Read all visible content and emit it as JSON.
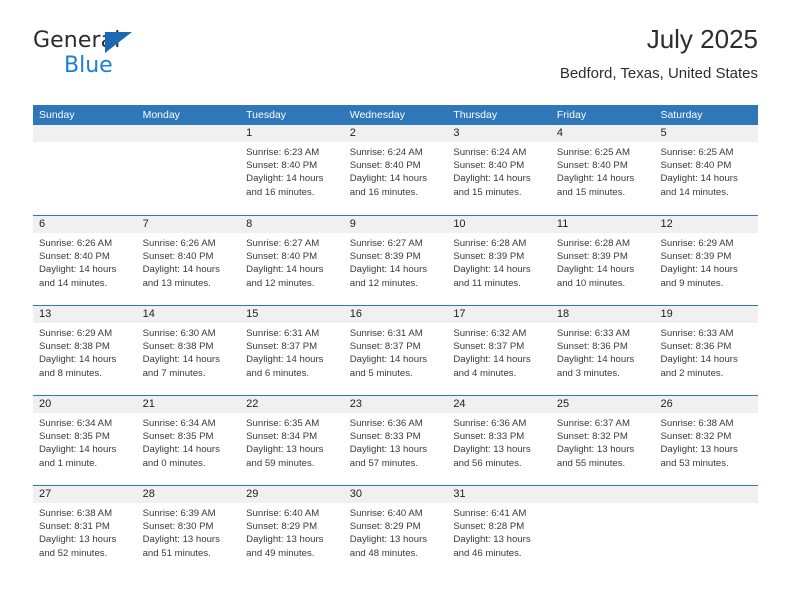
{
  "brand": {
    "name_top": "General",
    "name_bottom": "Blue",
    "triangle_color": "#1b69b2",
    "blue_color": "#1b7fd4"
  },
  "header": {
    "title": "July 2025",
    "subtitle": "Bedford, Texas, United States"
  },
  "theme": {
    "header_band": "#2e77b8",
    "day_band": "#f0f0f0",
    "text": "#222222"
  },
  "calendar": {
    "weekday_headers": [
      "Sunday",
      "Monday",
      "Tuesday",
      "Wednesday",
      "Thursday",
      "Friday",
      "Saturday"
    ],
    "weeks": [
      [
        {
          "day": "",
          "sunrise": "",
          "sunset": "",
          "daylight_1": "",
          "daylight_2": ""
        },
        {
          "day": "",
          "sunrise": "",
          "sunset": "",
          "daylight_1": "",
          "daylight_2": ""
        },
        {
          "day": "1",
          "sunrise": "Sunrise: 6:23 AM",
          "sunset": "Sunset: 8:40 PM",
          "daylight_1": "Daylight: 14 hours",
          "daylight_2": "and 16 minutes."
        },
        {
          "day": "2",
          "sunrise": "Sunrise: 6:24 AM",
          "sunset": "Sunset: 8:40 PM",
          "daylight_1": "Daylight: 14 hours",
          "daylight_2": "and 16 minutes."
        },
        {
          "day": "3",
          "sunrise": "Sunrise: 6:24 AM",
          "sunset": "Sunset: 8:40 PM",
          "daylight_1": "Daylight: 14 hours",
          "daylight_2": "and 15 minutes."
        },
        {
          "day": "4",
          "sunrise": "Sunrise: 6:25 AM",
          "sunset": "Sunset: 8:40 PM",
          "daylight_1": "Daylight: 14 hours",
          "daylight_2": "and 15 minutes."
        },
        {
          "day": "5",
          "sunrise": "Sunrise: 6:25 AM",
          "sunset": "Sunset: 8:40 PM",
          "daylight_1": "Daylight: 14 hours",
          "daylight_2": "and 14 minutes."
        }
      ],
      [
        {
          "day": "6",
          "sunrise": "Sunrise: 6:26 AM",
          "sunset": "Sunset: 8:40 PM",
          "daylight_1": "Daylight: 14 hours",
          "daylight_2": "and 14 minutes."
        },
        {
          "day": "7",
          "sunrise": "Sunrise: 6:26 AM",
          "sunset": "Sunset: 8:40 PM",
          "daylight_1": "Daylight: 14 hours",
          "daylight_2": "and 13 minutes."
        },
        {
          "day": "8",
          "sunrise": "Sunrise: 6:27 AM",
          "sunset": "Sunset: 8:40 PM",
          "daylight_1": "Daylight: 14 hours",
          "daylight_2": "and 12 minutes."
        },
        {
          "day": "9",
          "sunrise": "Sunrise: 6:27 AM",
          "sunset": "Sunset: 8:39 PM",
          "daylight_1": "Daylight: 14 hours",
          "daylight_2": "and 12 minutes."
        },
        {
          "day": "10",
          "sunrise": "Sunrise: 6:28 AM",
          "sunset": "Sunset: 8:39 PM",
          "daylight_1": "Daylight: 14 hours",
          "daylight_2": "and 11 minutes."
        },
        {
          "day": "11",
          "sunrise": "Sunrise: 6:28 AM",
          "sunset": "Sunset: 8:39 PM",
          "daylight_1": "Daylight: 14 hours",
          "daylight_2": "and 10 minutes."
        },
        {
          "day": "12",
          "sunrise": "Sunrise: 6:29 AM",
          "sunset": "Sunset: 8:39 PM",
          "daylight_1": "Daylight: 14 hours",
          "daylight_2": "and 9 minutes."
        }
      ],
      [
        {
          "day": "13",
          "sunrise": "Sunrise: 6:29 AM",
          "sunset": "Sunset: 8:38 PM",
          "daylight_1": "Daylight: 14 hours",
          "daylight_2": "and 8 minutes."
        },
        {
          "day": "14",
          "sunrise": "Sunrise: 6:30 AM",
          "sunset": "Sunset: 8:38 PM",
          "daylight_1": "Daylight: 14 hours",
          "daylight_2": "and 7 minutes."
        },
        {
          "day": "15",
          "sunrise": "Sunrise: 6:31 AM",
          "sunset": "Sunset: 8:37 PM",
          "daylight_1": "Daylight: 14 hours",
          "daylight_2": "and 6 minutes."
        },
        {
          "day": "16",
          "sunrise": "Sunrise: 6:31 AM",
          "sunset": "Sunset: 8:37 PM",
          "daylight_1": "Daylight: 14 hours",
          "daylight_2": "and 5 minutes."
        },
        {
          "day": "17",
          "sunrise": "Sunrise: 6:32 AM",
          "sunset": "Sunset: 8:37 PM",
          "daylight_1": "Daylight: 14 hours",
          "daylight_2": "and 4 minutes."
        },
        {
          "day": "18",
          "sunrise": "Sunrise: 6:33 AM",
          "sunset": "Sunset: 8:36 PM",
          "daylight_1": "Daylight: 14 hours",
          "daylight_2": "and 3 minutes."
        },
        {
          "day": "19",
          "sunrise": "Sunrise: 6:33 AM",
          "sunset": "Sunset: 8:36 PM",
          "daylight_1": "Daylight: 14 hours",
          "daylight_2": "and 2 minutes."
        }
      ],
      [
        {
          "day": "20",
          "sunrise": "Sunrise: 6:34 AM",
          "sunset": "Sunset: 8:35 PM",
          "daylight_1": "Daylight: 14 hours",
          "daylight_2": "and 1 minute."
        },
        {
          "day": "21",
          "sunrise": "Sunrise: 6:34 AM",
          "sunset": "Sunset: 8:35 PM",
          "daylight_1": "Daylight: 14 hours",
          "daylight_2": "and 0 minutes."
        },
        {
          "day": "22",
          "sunrise": "Sunrise: 6:35 AM",
          "sunset": "Sunset: 8:34 PM",
          "daylight_1": "Daylight: 13 hours",
          "daylight_2": "and 59 minutes."
        },
        {
          "day": "23",
          "sunrise": "Sunrise: 6:36 AM",
          "sunset": "Sunset: 8:33 PM",
          "daylight_1": "Daylight: 13 hours",
          "daylight_2": "and 57 minutes."
        },
        {
          "day": "24",
          "sunrise": "Sunrise: 6:36 AM",
          "sunset": "Sunset: 8:33 PM",
          "daylight_1": "Daylight: 13 hours",
          "daylight_2": "and 56 minutes."
        },
        {
          "day": "25",
          "sunrise": "Sunrise: 6:37 AM",
          "sunset": "Sunset: 8:32 PM",
          "daylight_1": "Daylight: 13 hours",
          "daylight_2": "and 55 minutes."
        },
        {
          "day": "26",
          "sunrise": "Sunrise: 6:38 AM",
          "sunset": "Sunset: 8:32 PM",
          "daylight_1": "Daylight: 13 hours",
          "daylight_2": "and 53 minutes."
        }
      ],
      [
        {
          "day": "27",
          "sunrise": "Sunrise: 6:38 AM",
          "sunset": "Sunset: 8:31 PM",
          "daylight_1": "Daylight: 13 hours",
          "daylight_2": "and 52 minutes."
        },
        {
          "day": "28",
          "sunrise": "Sunrise: 6:39 AM",
          "sunset": "Sunset: 8:30 PM",
          "daylight_1": "Daylight: 13 hours",
          "daylight_2": "and 51 minutes."
        },
        {
          "day": "29",
          "sunrise": "Sunrise: 6:40 AM",
          "sunset": "Sunset: 8:29 PM",
          "daylight_1": "Daylight: 13 hours",
          "daylight_2": "and 49 minutes."
        },
        {
          "day": "30",
          "sunrise": "Sunrise: 6:40 AM",
          "sunset": "Sunset: 8:29 PM",
          "daylight_1": "Daylight: 13 hours",
          "daylight_2": "and 48 minutes."
        },
        {
          "day": "31",
          "sunrise": "Sunrise: 6:41 AM",
          "sunset": "Sunset: 8:28 PM",
          "daylight_1": "Daylight: 13 hours",
          "daylight_2": "and 46 minutes."
        },
        {
          "day": "",
          "sunrise": "",
          "sunset": "",
          "daylight_1": "",
          "daylight_2": ""
        },
        {
          "day": "",
          "sunrise": "",
          "sunset": "",
          "daylight_1": "",
          "daylight_2": ""
        }
      ]
    ]
  }
}
